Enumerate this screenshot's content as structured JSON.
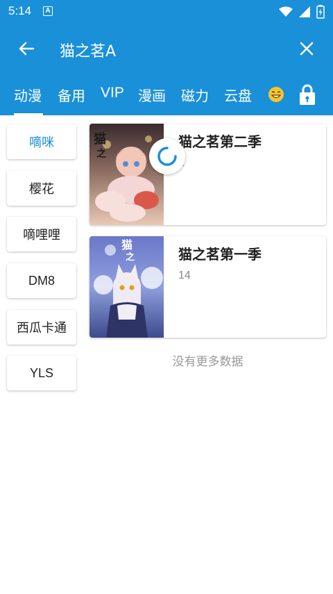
{
  "status": {
    "time": "5:14",
    "notification_icon": "A"
  },
  "appbar": {
    "search_text": "猫之茗A"
  },
  "tabs": [
    {
      "label": "动漫"
    },
    {
      "label": "备用"
    },
    {
      "label": "VIP"
    },
    {
      "label": "漫画"
    },
    {
      "label": "磁力"
    },
    {
      "label": "云盘"
    }
  ],
  "sources": [
    {
      "label": "嘀咪",
      "active": true
    },
    {
      "label": "樱花"
    },
    {
      "label": "嘀哩哩"
    },
    {
      "label": "DM8"
    },
    {
      "label": "西瓜卡通"
    },
    {
      "label": "YLS"
    }
  ],
  "results": [
    {
      "title": "猫之茗第二季",
      "subtitle": "1"
    },
    {
      "title": "猫之茗第一季",
      "subtitle": "14"
    }
  ],
  "footer": {
    "no_more": "没有更多数据"
  },
  "colors": {
    "primary": "#1a90d9",
    "active_text": "#1a90d9"
  }
}
